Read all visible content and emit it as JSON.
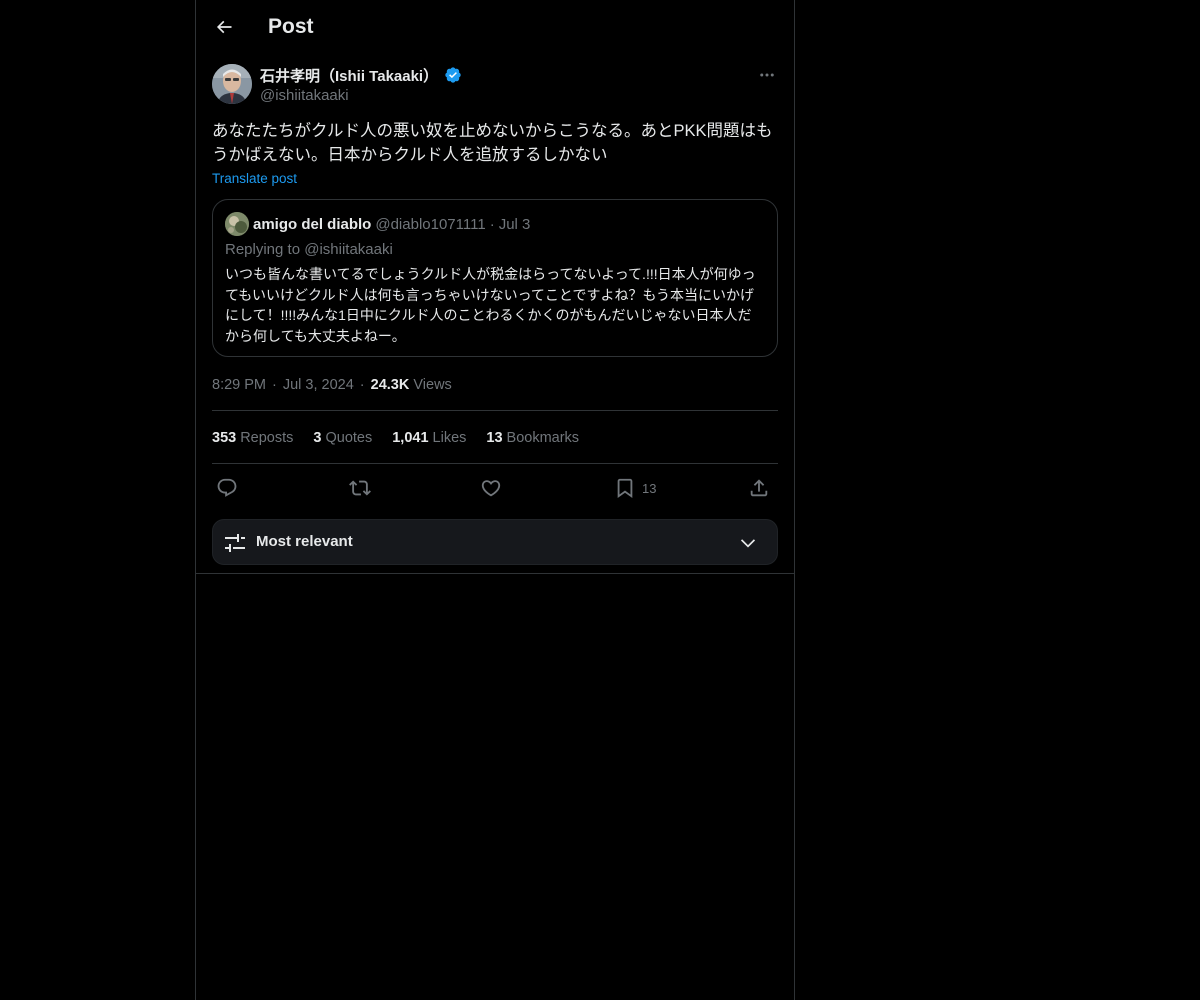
{
  "header": {
    "title": "Post",
    "back_icon": "arrow-left-icon"
  },
  "post": {
    "author_name": "石井孝明（Ishii Takaaki）",
    "author_handle": "@ishiitakaaki",
    "verified": true,
    "text": "あなたたちがクルド人の悪い奴を止めないからこうなる。あとPKK問題はもうかばえない。日本からクルド人を追放するしかない",
    "translate_label": "Translate post",
    "time": "8:29 PM",
    "date": "Jul 3, 2024",
    "views_count": "24.3K",
    "views_label": "Views"
  },
  "quote": {
    "author_name": "amigo del diablo",
    "author_handle": "@diablo1071111",
    "separator": "·",
    "date": "Jul 3",
    "replying_to": "Replying to @ishiitakaaki",
    "text": "いつも皆んな書いてるでしょうクルド人が税金はらってないよって.!!!日本人が何ゆってもいいけどクルド人は何も言っちゃいけないってことですよね？もう本当にいかげにして！!!!!みんな1日中にクルド人のことわるくかくのがもんだいじゃない日本人だから何しても大丈夫よねー。"
  },
  "stats": {
    "reposts_count": "353",
    "reposts_label": "Reposts",
    "quotes_count": "3",
    "quotes_label": "Quotes",
    "likes_count": "1,041",
    "likes_label": "Likes",
    "bookmarks_count": "13",
    "bookmarks_label": "Bookmarks"
  },
  "actions": {
    "reply_icon": "reply-icon",
    "repost_icon": "repost-icon",
    "like_icon": "heart-icon",
    "bookmark_icon": "bookmark-icon",
    "bookmark_count": "13",
    "share_icon": "share-icon"
  },
  "sort": {
    "label": "Most relevant",
    "icon": "sliders-icon",
    "chevron": "chevron-down-icon"
  },
  "colors": {
    "background": "#000000",
    "text_primary": "#e7e9ea",
    "text_secondary": "#71767b",
    "link": "#1d9bf0",
    "border": "#2f3336",
    "verified_badge": "#1d9bf0"
  }
}
